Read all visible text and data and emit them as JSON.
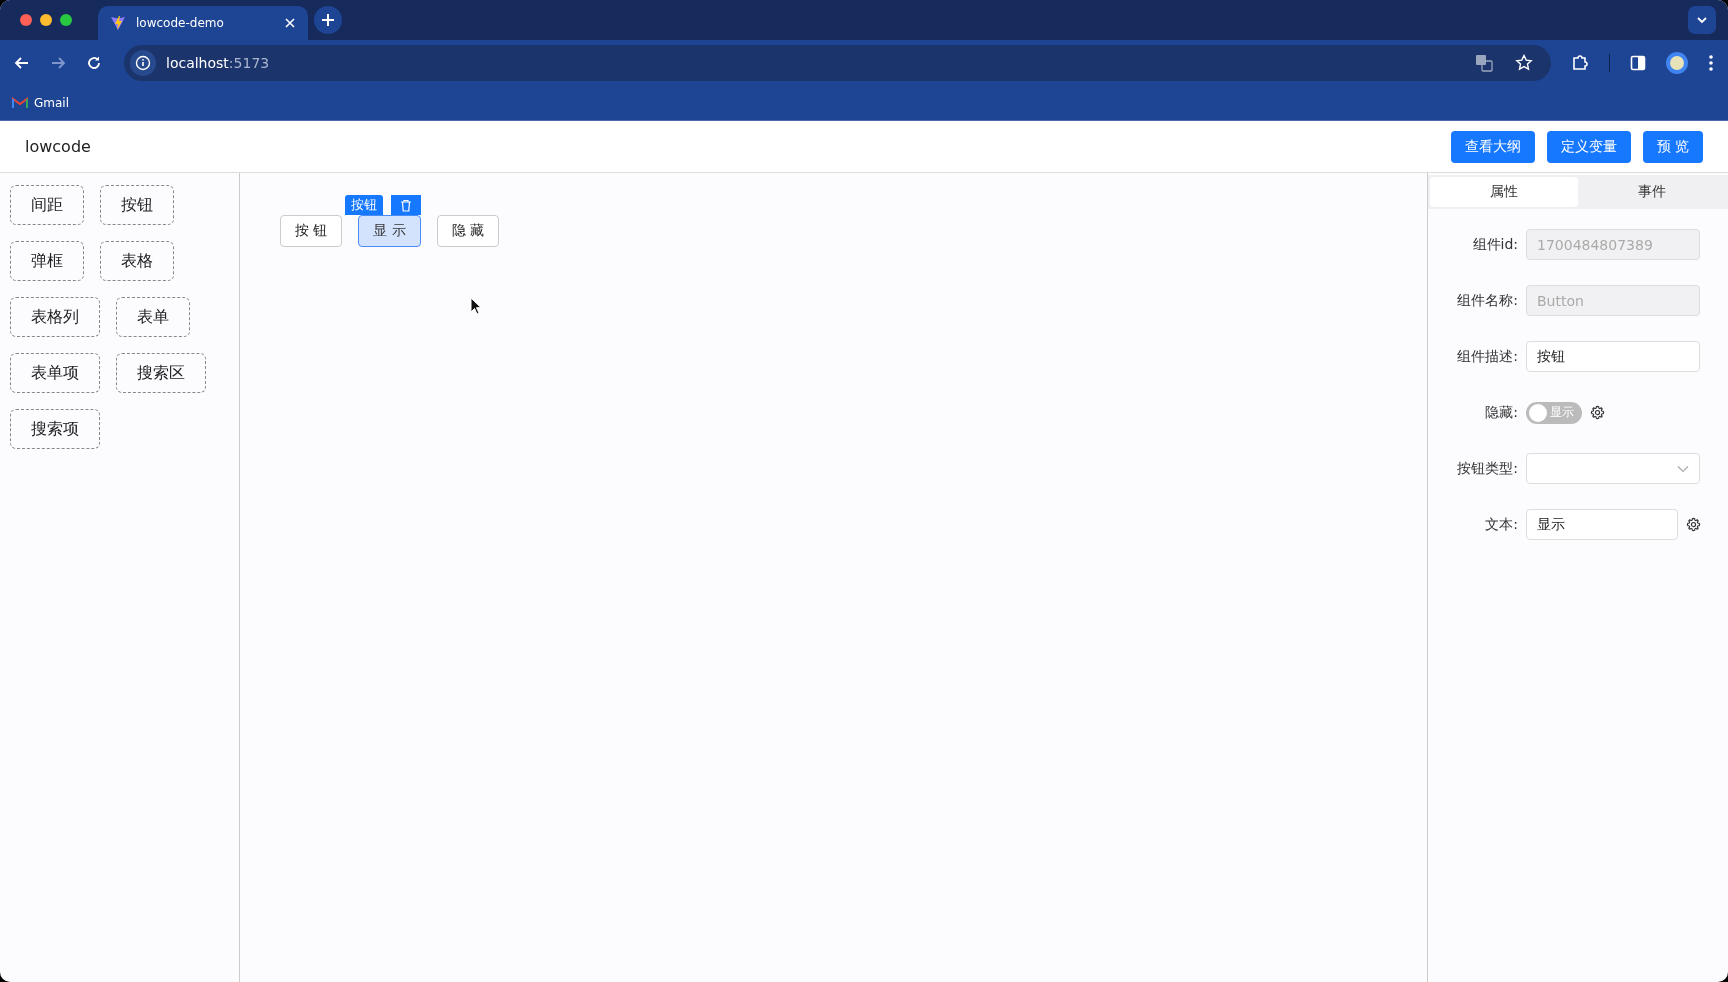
{
  "browser": {
    "tab_title": "lowcode-demo",
    "url_host": "localhost",
    "url_port": ":5173",
    "bookmarks": [
      "Gmail"
    ]
  },
  "header": {
    "title": "lowcode",
    "buttons": [
      "查看大纲",
      "定义变量",
      "预 览"
    ]
  },
  "palette": {
    "items": [
      "间距",
      "按钮",
      "弹框",
      "表格",
      "表格列",
      "表单",
      "表单项",
      "搜索区",
      "搜索项"
    ]
  },
  "canvas": {
    "selection_tag": "按钮",
    "components": [
      {
        "label": "按 钮",
        "selected": false
      },
      {
        "label": "显 示",
        "selected": true
      },
      {
        "label": "隐 藏",
        "selected": false
      }
    ]
  },
  "properties": {
    "tabs": [
      {
        "label": "属性",
        "selected": true
      },
      {
        "label": "事件",
        "selected": false
      }
    ],
    "fields": [
      {
        "kind": "input",
        "label": "组件id:",
        "value": "1700484807389",
        "disabled": true,
        "gear": false
      },
      {
        "kind": "input",
        "label": "组件名称:",
        "value": "Button",
        "disabled": true,
        "gear": false
      },
      {
        "kind": "input",
        "label": "组件描述:",
        "value": "按钮",
        "disabled": false,
        "gear": false
      },
      {
        "kind": "switch",
        "label": "隐藏:",
        "on": false,
        "text": "显示",
        "gear": true
      },
      {
        "kind": "select",
        "label": "按钮类型:",
        "gear": false
      },
      {
        "kind": "input",
        "label": "文本:",
        "value": "显示",
        "disabled": false,
        "gear": true
      }
    ]
  }
}
